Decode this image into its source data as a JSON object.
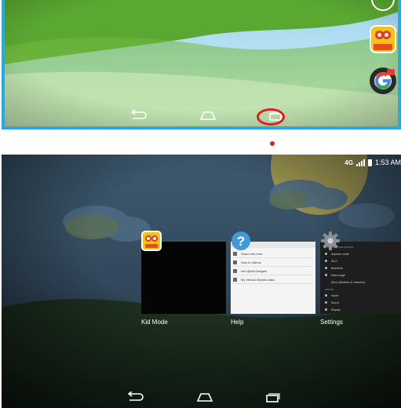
{
  "top_screen": {
    "home_apps": [
      {
        "name": "Kid Mode",
        "icon": "kid-mode-app-icon"
      },
      {
        "name": "",
        "icon": "google-app-icon"
      }
    ],
    "nav": [
      "back-icon",
      "home-icon",
      "recents-icon"
    ],
    "highlighted_button": "recents-icon",
    "highlight_color": "#e02020",
    "frame_color": "#29a8e6"
  },
  "recents_screen": {
    "status_bar": {
      "network": "4G",
      "time": "1:53 AM"
    },
    "recent_apps": [
      {
        "label": "Kid Mode",
        "icon": "kid-mode-app-icon"
      },
      {
        "label": "Help",
        "icon": "help-icon",
        "preview_items": [
          "Some Info here",
          "How to Videos",
          "Info @kid.Gadgets",
          "My Verizon Mobile video"
        ]
      },
      {
        "label": "Settings",
        "icon": "settings-gear-icon",
        "preview_items": [
          {
            "type": "header",
            "text": "WIRELESS & NETWORKS"
          },
          {
            "type": "item",
            "text": "Airplane mode"
          },
          {
            "type": "item",
            "text": "Wi-Fi"
          },
          {
            "type": "item",
            "text": "Bluetooth"
          },
          {
            "type": "item",
            "text": "Data usage"
          },
          {
            "type": "item",
            "text": "More (Wireless & networks)"
          },
          {
            "type": "header",
            "text": "DEVICE"
          },
          {
            "type": "item",
            "text": "Home"
          },
          {
            "type": "item",
            "text": "Sound"
          },
          {
            "type": "item",
            "text": "Display"
          }
        ]
      }
    ],
    "nav": [
      "back-icon",
      "home-icon",
      "recents-icon"
    ]
  },
  "colors": {
    "arrow": "#e53935",
    "nav_icon": "#ffffff"
  }
}
